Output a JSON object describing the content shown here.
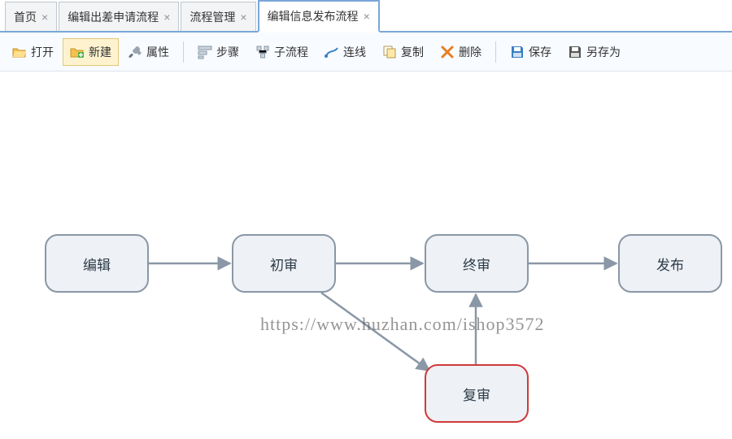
{
  "tabs": [
    {
      "label": "首页",
      "active": false
    },
    {
      "label": "编辑出差申请流程",
      "active": false
    },
    {
      "label": "流程管理",
      "active": false
    },
    {
      "label": "编辑信息发布流程",
      "active": true
    }
  ],
  "toolbar": {
    "open": "打开",
    "new": "新建",
    "props": "属性",
    "step": "步骤",
    "subflow": "子流程",
    "connector": "连线",
    "copy": "复制",
    "delete": "删除",
    "save": "保存",
    "saveas": "另存为"
  },
  "nodes": {
    "edit": "编辑",
    "first_review": "初审",
    "final_review": "终审",
    "publish": "发布",
    "re_review": "复审"
  },
  "watermark": "https://www.huzhan.com/ishop3572",
  "colors": {
    "tab_accent": "#7aa7d8",
    "node_border": "#8a97a6",
    "node_border_red": "#d03a3a",
    "node_fill": "#eef1f5"
  },
  "icons": {
    "open": "folder-open-icon",
    "new": "folder-plus-icon",
    "props": "wrench-icon",
    "step": "steps-icon",
    "subflow": "subflow-icon",
    "connector": "connector-icon",
    "copy": "copy-icon",
    "delete": "delete-x-icon",
    "save": "floppy-icon",
    "saveas": "floppy-icon"
  }
}
